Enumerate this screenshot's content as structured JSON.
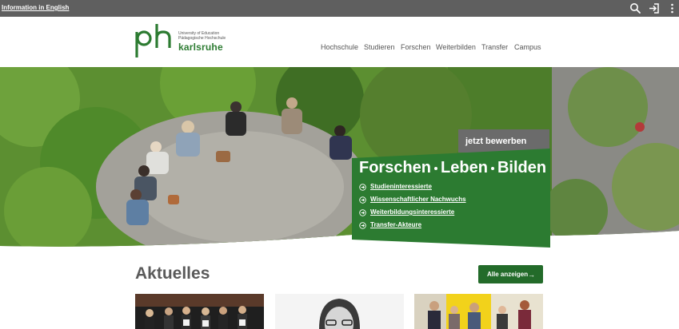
{
  "topbar": {
    "language_link": "Information in English",
    "icons": [
      "search-icon",
      "login-icon",
      "more-vertical-icon"
    ]
  },
  "logo": {
    "mark": "ph",
    "subtitle_line1": "University of Education",
    "subtitle_line2": "Pädagogische Hochschule",
    "wordmark": "karlsruhe"
  },
  "nav": {
    "items": [
      {
        "label": "Hochschule"
      },
      {
        "label": "Studieren"
      },
      {
        "label": "Forschen"
      },
      {
        "label": "Weiterbilden"
      },
      {
        "label": "Transfer"
      },
      {
        "label": "Campus"
      }
    ]
  },
  "hero": {
    "apply_button": "jetzt bewerben",
    "headline_parts": [
      "Forschen",
      "Leben",
      "Bilden"
    ],
    "links": [
      {
        "label": "Studieninteressierte"
      },
      {
        "label": "Wissenschaftlicher Nachwuchs"
      },
      {
        "label": "Weiterbildungsinteressierte"
      },
      {
        "label": "Transfer-Akteure"
      }
    ]
  },
  "news": {
    "title": "Aktuelles",
    "all_button": "Alle anzeigen",
    "cards": [
      {
        "image": "group-photo"
      },
      {
        "image": "portrait-photo"
      },
      {
        "image": "award-photo"
      }
    ]
  },
  "colors": {
    "topbar": "#5f5f5f",
    "brand_green": "#2c7b31",
    "button_green": "#236b2a",
    "apply_grey": "#6b6b6b",
    "title_grey": "#5a5a5a"
  }
}
